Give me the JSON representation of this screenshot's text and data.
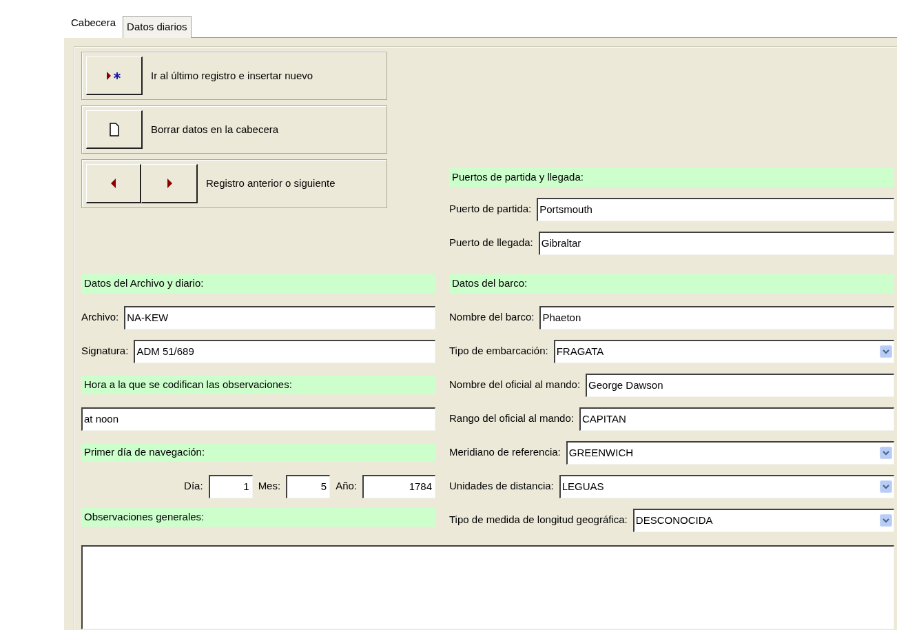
{
  "tabs": [
    {
      "label": "Cabecera",
      "selected": true
    },
    {
      "label": "Datos diarios",
      "selected": false
    }
  ],
  "actions": [
    {
      "kind": "new",
      "label": "Ir al último registro e insertar nuevo"
    },
    {
      "kind": "clear",
      "label": "Borrar datos en la cabecera"
    },
    {
      "kind": "nav",
      "label": "Registro anterior o siguiente"
    }
  ],
  "ports": {
    "heading": "Puertos de partida y llegada:",
    "fields": [
      {
        "kind": "text",
        "label": "Puerto de partida:",
        "value": "Portsmouth"
      },
      {
        "kind": "text",
        "label": "Puerto de llegada:",
        "value": "Gibraltar"
      }
    ]
  },
  "archive": {
    "heading": "Datos del Archivo y diario:",
    "fields": [
      {
        "kind": "text",
        "label": "Archivo:",
        "value": "NA-KEW"
      },
      {
        "kind": "text",
        "label": "Signatura:",
        "value": "ADM 51/689"
      }
    ]
  },
  "observation_time": {
    "heading": "Hora a la que se codifican las observaciones:",
    "value": "at noon"
  },
  "first_day": {
    "heading": "Primer día de navegación:",
    "parts": [
      {
        "label": "Día:",
        "value": "1"
      },
      {
        "label": "Mes:",
        "value": "5"
      },
      {
        "label": "Año:",
        "value": "1784"
      }
    ]
  },
  "remarks": {
    "heading": "Observaciones generales:"
  },
  "ship": {
    "heading": "Datos del barco:",
    "fields": [
      {
        "kind": "text",
        "label": "Nombre del barco:",
        "value": "Phaeton"
      },
      {
        "kind": "combo",
        "label": "Tipo de embarcación:",
        "value": "FRAGATA"
      },
      {
        "kind": "text",
        "label": "Nombre del oficial al mando:",
        "value": "George Dawson"
      },
      {
        "kind": "text",
        "label": "Rango del oficial al mando:",
        "value": "CAPITAN"
      },
      {
        "kind": "combo",
        "label": "Meridiano de referencia:",
        "value": "GREENWICH"
      },
      {
        "kind": "combo",
        "label": "Unidades de distancia:",
        "value": "LEGUAS"
      },
      {
        "kind": "combo",
        "label": "Tipo de medida de longitud geográfica:",
        "value": "DESCONOCIDA"
      }
    ]
  }
}
